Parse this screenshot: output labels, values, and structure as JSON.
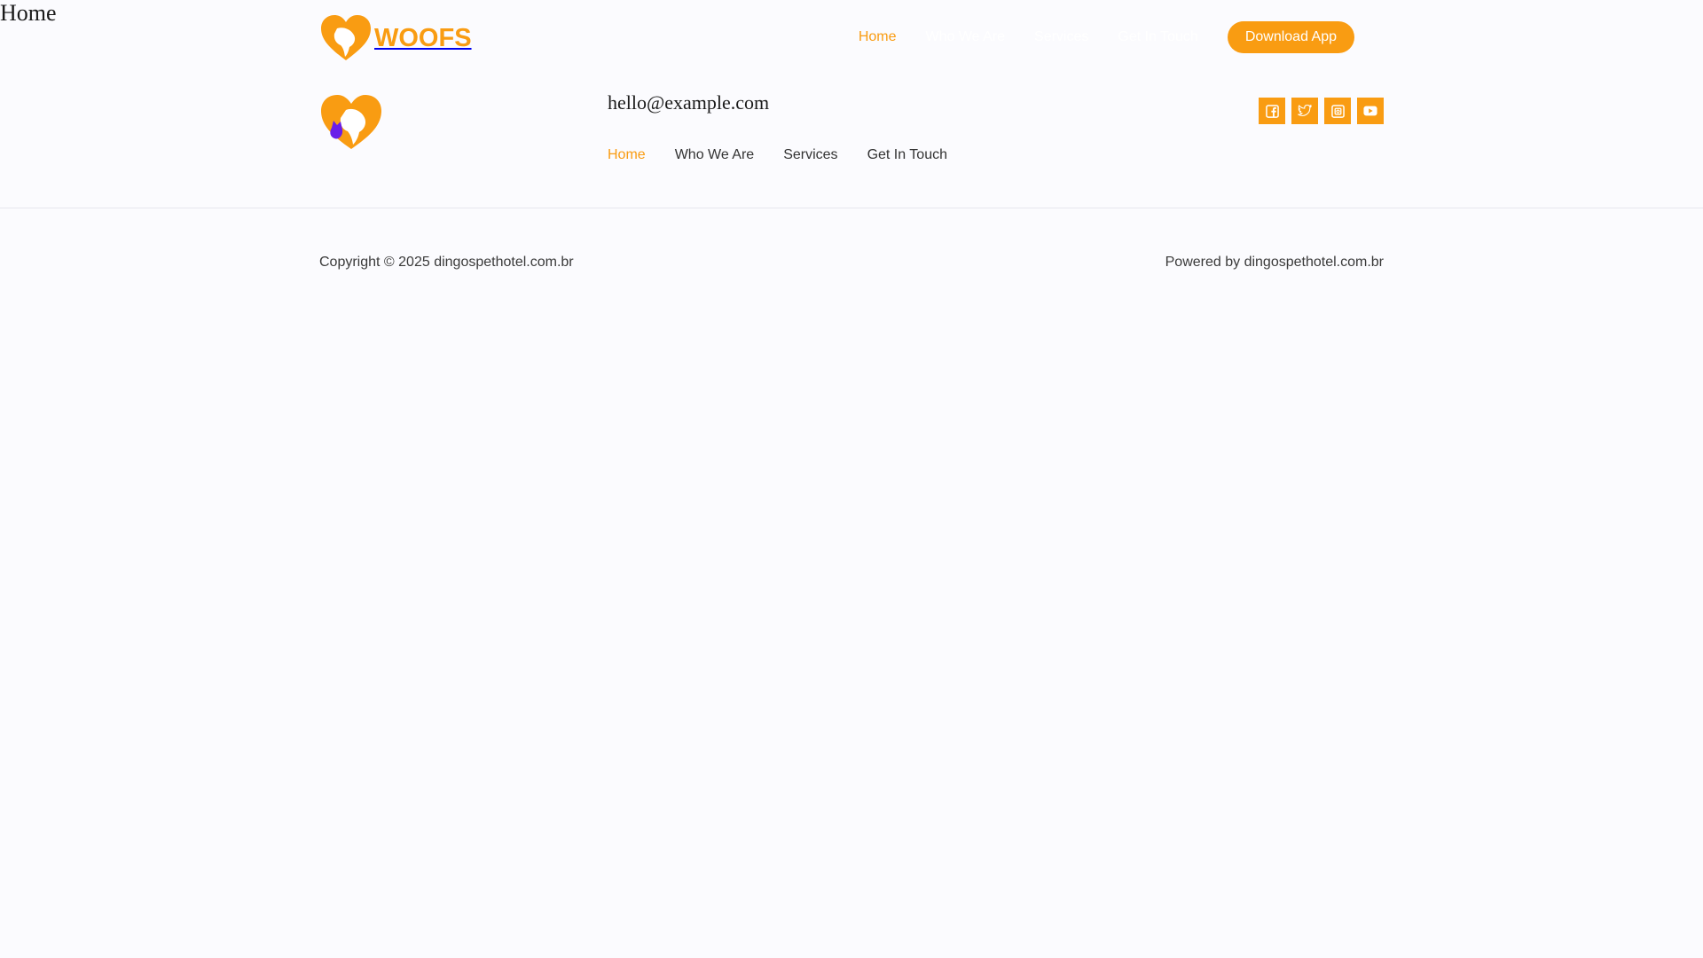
{
  "page": {
    "title": "Home"
  },
  "header": {
    "logo_text": "WOOFS",
    "nav": [
      {
        "label": "Home",
        "active": true
      },
      {
        "label": "Who We Are",
        "active": false
      },
      {
        "label": "Services",
        "active": false
      },
      {
        "label": "Get In Touch",
        "active": false
      }
    ],
    "cta_label": "Download App"
  },
  "sub_header": {
    "email": "hello@example.com",
    "nav": [
      {
        "label": "Home",
        "active": true
      },
      {
        "label": "Who We Are",
        "active": false
      },
      {
        "label": "Services",
        "active": false
      },
      {
        "label": "Get In Touch",
        "active": false
      }
    ],
    "socials": [
      "facebook-icon",
      "twitter-icon",
      "instagram-icon",
      "youtube-icon"
    ]
  },
  "footer": {
    "copyright": "Copyright © 2025 dingospethotel.com.br",
    "powered": "Powered by dingospethotel.com.br"
  },
  "colors": {
    "accent": "#f99c12",
    "purple": "#6a1ee8",
    "background": "#fbfbfe"
  }
}
